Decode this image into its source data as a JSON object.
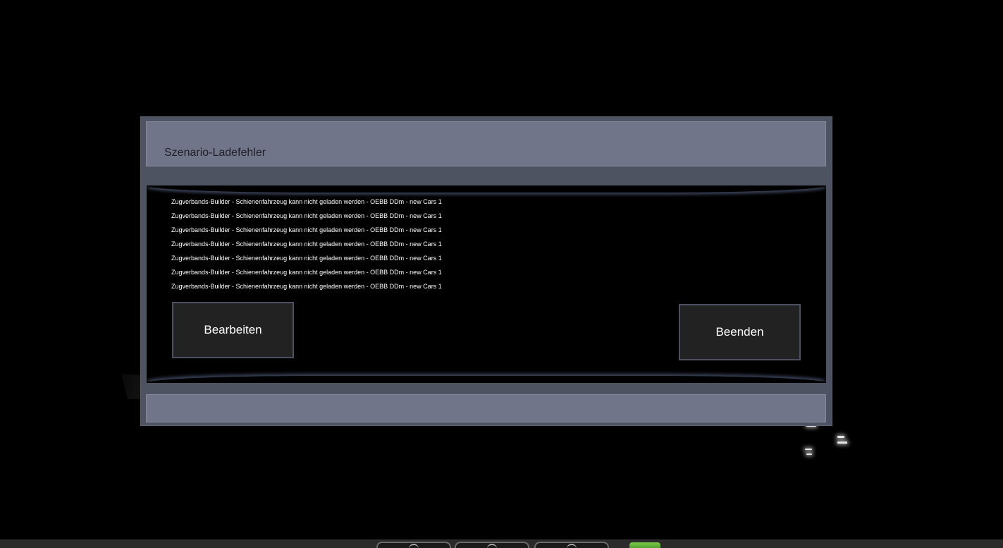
{
  "dialog": {
    "title": "Szenario-Ladefehler",
    "errors": [
      "Zugverbands-Builder - Schienenfahrzeug kann nicht geladen werden - OEBB DDm - new Cars 1",
      "Zugverbands-Builder - Schienenfahrzeug kann nicht geladen werden - OEBB DDm - new Cars 1",
      "Zugverbands-Builder - Schienenfahrzeug kann nicht geladen werden - OEBB DDm - new Cars 1",
      "Zugverbands-Builder - Schienenfahrzeug kann nicht geladen werden - OEBB DDm - new Cars 1",
      "Zugverbands-Builder - Schienenfahrzeug kann nicht geladen werden - OEBB DDm - new Cars 1",
      "Zugverbands-Builder - Schienenfahrzeug kann nicht geladen werden - OEBB DDm - new Cars 1",
      "Zugverbands-Builder - Schienenfahrzeug kann nicht geladen werden - OEBB DDm - new Cars 1"
    ],
    "edit_label": "Bearbeiten",
    "quit_label": "Beenden"
  },
  "taskbar": {
    "buttons": [
      "taskbar-button-1",
      "taskbar-button-2",
      "taskbar-button-3"
    ],
    "accent_icon": "green-status-icon"
  },
  "colors": {
    "dialog_frame": "#4e5362",
    "title_bar": "#717589",
    "button_bg": "#222222",
    "content_bg": "#000000"
  }
}
